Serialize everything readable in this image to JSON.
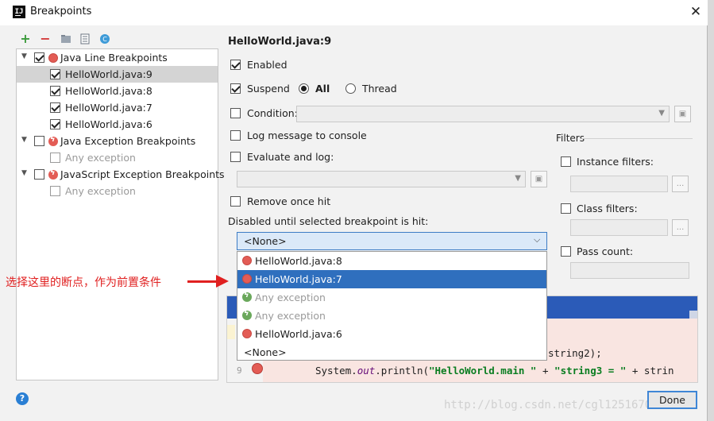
{
  "window": {
    "title": "Breakpoints",
    "close_glyph": "✕"
  },
  "toolbar": {
    "add_glyph": "+",
    "remove_glyph": "−",
    "folder_icon": "folder-icon",
    "group_icon": "group-icon",
    "class_icon": "class-icon"
  },
  "tree": {
    "items": [
      {
        "label": "Java Line Breakpoints",
        "checked": true
      },
      {
        "label": "HelloWorld.java:9",
        "checked": true,
        "selected": true
      },
      {
        "label": "HelloWorld.java:8",
        "checked": true
      },
      {
        "label": "HelloWorld.java:7",
        "checked": true
      },
      {
        "label": "HelloWorld.java:6",
        "checked": true
      },
      {
        "label": "Java Exception Breakpoints",
        "checked": false
      },
      {
        "label": "Any exception",
        "checked": false
      },
      {
        "label": "JavaScript Exception Breakpoints",
        "checked": false
      },
      {
        "label": "Any exception",
        "checked": false
      }
    ]
  },
  "panel": {
    "title": "HelloWorld.java:9",
    "enabled_label": "Enabled",
    "suspend_label": "Suspend",
    "all_label": "All",
    "thread_label": "Thread",
    "condition_label": "Condition:",
    "log_message_label": "Log message to console",
    "evaluate_label": "Evaluate and log:",
    "remove_once_label": "Remove once hit",
    "disabled_until_label": "Disabled until selected breakpoint is hit:"
  },
  "filters": {
    "title": "Filters",
    "instance_label": "Instance filters:",
    "class_label": "Class filters:",
    "pass_count_label": "Pass count:",
    "ellipsis": "..."
  },
  "dropdown": {
    "selected": "<None>",
    "items": [
      {
        "label": "HelloWorld.java:8",
        "icon": "breakpoint-icon"
      },
      {
        "label": "HelloWorld.java:7",
        "icon": "breakpoint-icon",
        "highlighted": true
      },
      {
        "label": "Any exception",
        "icon": "exception-breakpoint-icon",
        "muted": true
      },
      {
        "label": "Any exception",
        "icon": "exception-breakpoint-icon",
        "muted": true
      },
      {
        "label": "HelloWorld.java:6",
        "icon": "breakpoint-icon"
      },
      {
        "label": "<None>",
        "icon": ""
      }
    ]
  },
  "editor": {
    "partial_line": "string2);",
    "line_number": "9",
    "line_code_prefix": "System.",
    "line_code_field": "out",
    "line_code_rest": ".println(",
    "line_code_string1": "\"HelloWorld.main \"",
    "line_code_plus1": " + ",
    "line_code_string2": "\"string3 = \"",
    "line_code_tail": " + strin"
  },
  "annotation": {
    "text": "选择这里的断点，作为前置条件"
  },
  "buttons": {
    "done_label": "Done",
    "help_glyph": "?"
  },
  "watermark": "http://blog.csdn.net/cgl125167016"
}
